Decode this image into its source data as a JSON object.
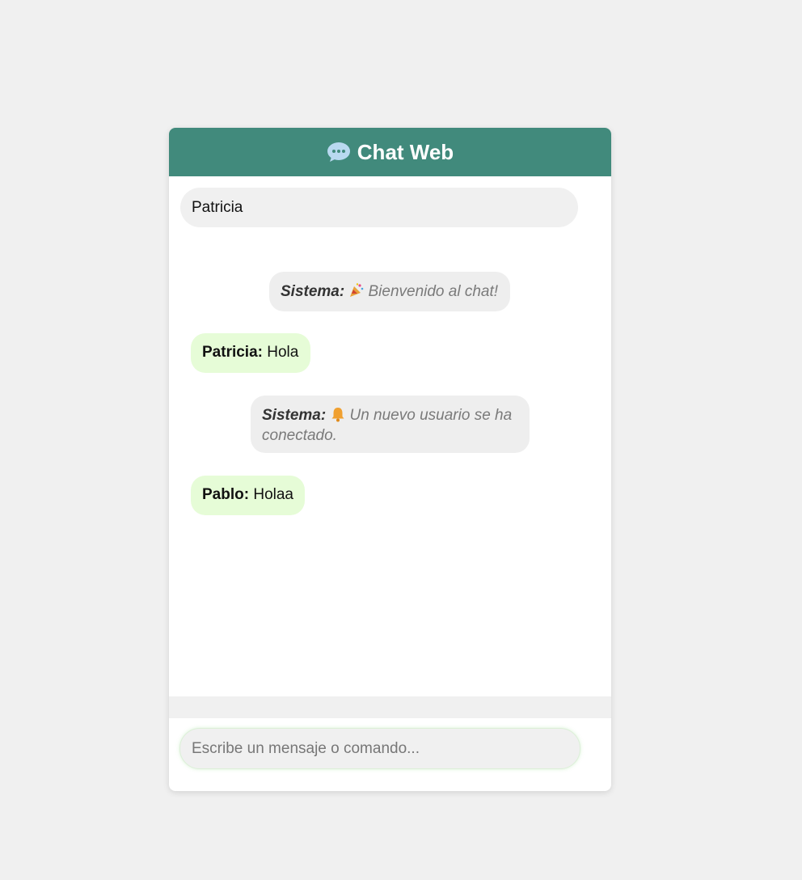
{
  "header": {
    "icon": "speech-bubble-icon",
    "title": "Chat Web",
    "color": "#418a7c"
  },
  "username": {
    "value": "Patricia"
  },
  "messages": [
    {
      "type": "system",
      "sender": "Sistema:",
      "icon": "party-popper-icon",
      "text": "Bienvenido al chat!"
    },
    {
      "type": "user",
      "sender": "Patricia:",
      "text": "Hola"
    },
    {
      "type": "system",
      "sender": "Sistema:",
      "icon": "bell-icon",
      "text": "Un nuevo usuario se ha conectado."
    },
    {
      "type": "user",
      "sender": "Pablo:",
      "text": "Holaa"
    }
  ],
  "composer": {
    "placeholder": "Escribe un mensaje o comando..."
  }
}
